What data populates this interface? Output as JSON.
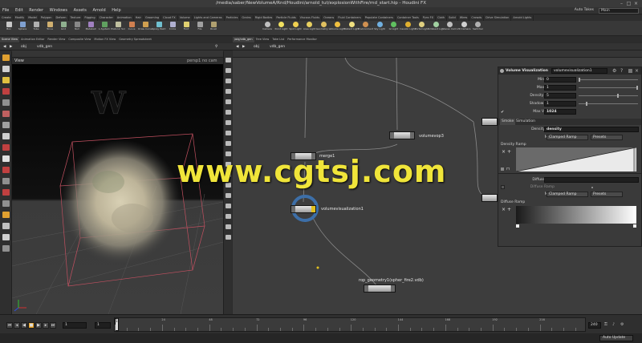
{
  "window": {
    "title": "/media/saber/NewVolumeA/Rnd/Houdini/arnold_tut/explosionWithFire/rnd_start.hip - Houdini FX"
  },
  "menubar": {
    "items": [
      "File",
      "Edit",
      "Render",
      "Windows",
      "Assets",
      "Arnold",
      "Help"
    ],
    "auto_takes": "Auto Takes",
    "desktop": "Main"
  },
  "shelf_tabs": [
    "Create",
    "Modify",
    "Model",
    "Polygon",
    "Deform",
    "Texture",
    "Rigging",
    "Character",
    "Animation",
    "Hair",
    "Grooming",
    "Cloud FX",
    "Volume",
    "Lights and Cameras",
    "Particles",
    "Grains",
    "Rigid Bodies",
    "Particle Fluids",
    "Viscous Fluids",
    "Oceans",
    "Fluid Containers",
    "Populate Containers",
    "Container Tools",
    "Pyro FX",
    "Cloth",
    "Solid",
    "Wires",
    "Crowds",
    "Drive Simulation",
    "Arnold Lights"
  ],
  "shelf_tools_left": [
    "Box",
    "Sphere",
    "Tube",
    "Torus",
    "Grid",
    "Null",
    "Metaball",
    "L-System",
    "Platonic Sol",
    "Curve",
    "Draw Curve",
    "Spray Paint",
    "Circle",
    "Font",
    "File",
    "Rivet"
  ],
  "shelf_tools_right": [
    "Camera",
    "Point Light",
    "Spot Light",
    "Area Light",
    "Geometry L.",
    "Volume Light",
    "Distant Light",
    "Environment",
    "Sky Light",
    "GI Light",
    "Caustic Light",
    "Portal Light",
    "Ambient Lig.",
    "Stereo Cam.",
    "VR Camera",
    "Switcher"
  ],
  "left_pane_tabs": [
    "Scene View",
    "Animation Editor",
    "Render View",
    "Composite View",
    "Motion FX View",
    "Geometry Spreadsheet"
  ],
  "right_pane_tabs": [
    "/obj/vdb_gen",
    "Tree View",
    "Take List",
    "Performance Monitor"
  ],
  "left_path": {
    "root": "obj",
    "node": "vdb_gen"
  },
  "right_path": {
    "root": "obj",
    "node": "vdb_gen"
  },
  "viewport": {
    "label": "View",
    "persp": "persp1",
    "cam": "no cam"
  },
  "nodes": {
    "merge": "merge1",
    "volumevop": "volumevop3",
    "volumevis": "volumevisualization1",
    "rop": "rop_geometry1(spher_fire2.vdb)"
  },
  "params": {
    "type": "Volume Visualization",
    "name": "volumevisualization1",
    "rows": [
      {
        "label": "Minimum",
        "value": "0"
      },
      {
        "label": "Maximum",
        "value": "1"
      },
      {
        "label": "Density Scale",
        "value": "5"
      },
      {
        "label": "Shadow Scale",
        "value": "1"
      },
      {
        "label": "Max Vis Res",
        "value": "1024"
      }
    ],
    "tabs": [
      "Smoke",
      "Simulation"
    ],
    "density_field_label": "Density Field",
    "density_field": "density",
    "mode_label": "Mode",
    "mode_value": "Clamped Ramp",
    "presets": "Presets",
    "density_ramp": "Density Ramp",
    "diffuse_field": "Diffuse Field",
    "diffuse_ramp_label": "Diffuse Ramp",
    "diffuse_mode_value": "Clamped Ramp",
    "diffuse_ramp": "Diffuse Ramp"
  },
  "timeline": {
    "current_frame": "1",
    "start": "1",
    "end": "240",
    "ticks": [
      "1",
      "24",
      "48",
      "72",
      "96",
      "120",
      "144",
      "168",
      "192",
      "216",
      "240"
    ],
    "ruler_labels": [
      "1",
      "24",
      "48",
      "72",
      "96",
      "120",
      "144",
      "168",
      "192",
      "216"
    ]
  },
  "status": {
    "auto_update": "Auto Update"
  },
  "watermark": "www.cgtsj.com",
  "colors": {
    "accent": "#f0e53a",
    "selected_ring": "#3d6fa8",
    "node_flag": "#e0c020"
  }
}
